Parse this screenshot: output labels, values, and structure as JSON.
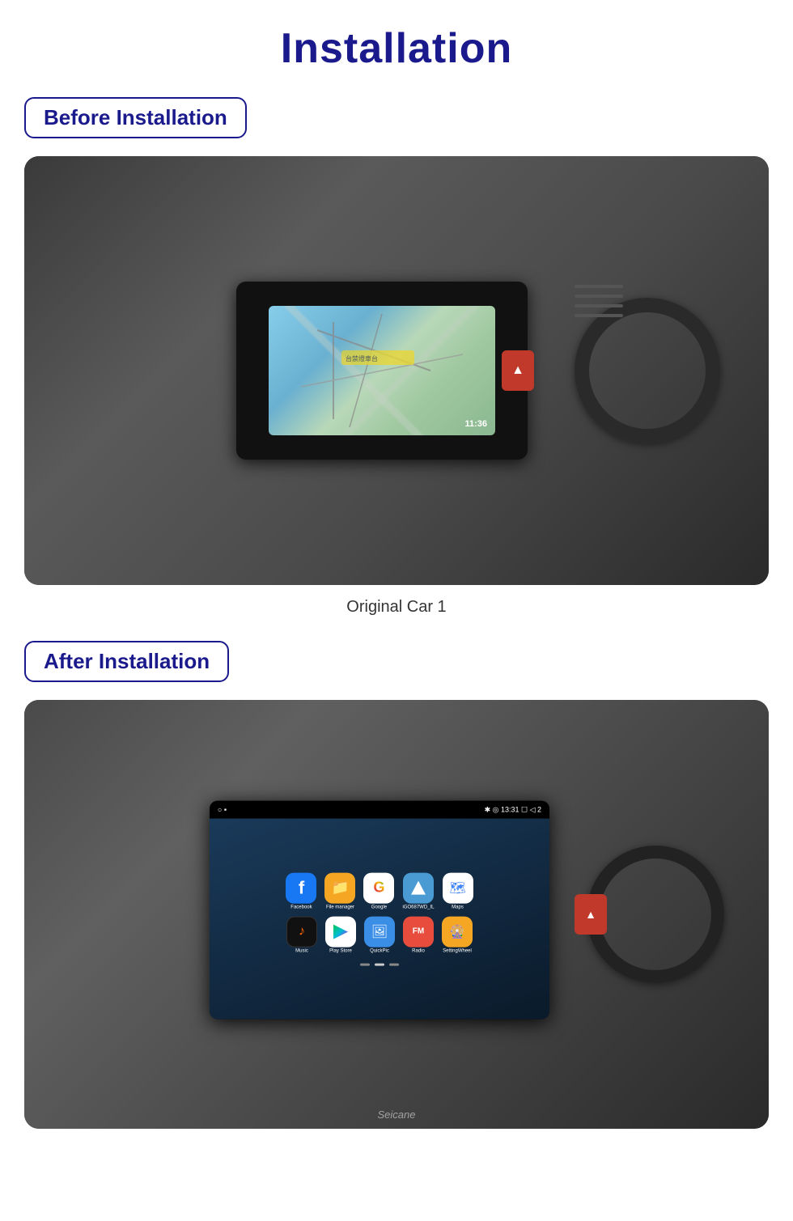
{
  "page": {
    "title": "Installation"
  },
  "before_section": {
    "badge_label": "Before Installation",
    "caption": "Original Car  1",
    "image_alt": "Car interior before installation showing original navigation screen"
  },
  "after_section": {
    "badge_label": "After Installation",
    "image_alt": "Car interior after installation showing Android head unit",
    "status_bar": {
      "left": "○  ▪",
      "time": "✱ ◎ 13:31  ☐  ◁  2"
    },
    "apps_row1": [
      {
        "name": "Facebook",
        "label": "Facebook"
      },
      {
        "name": "File manager",
        "label": "File manager"
      },
      {
        "name": "Google",
        "label": "Google"
      },
      {
        "name": "iGO687WD_IL",
        "label": "iGO687WD_IL"
      },
      {
        "name": "Maps",
        "label": "Maps"
      }
    ],
    "apps_row2": [
      {
        "name": "Music",
        "label": "Music"
      },
      {
        "name": "Play Store",
        "label": "Play Store"
      },
      {
        "name": "QuickPic",
        "label": "QuickPic"
      },
      {
        "name": "Radio",
        "label": "Radio"
      },
      {
        "name": "SettingWheel",
        "label": "SettingWheel"
      }
    ],
    "watermark": "Seicane"
  }
}
